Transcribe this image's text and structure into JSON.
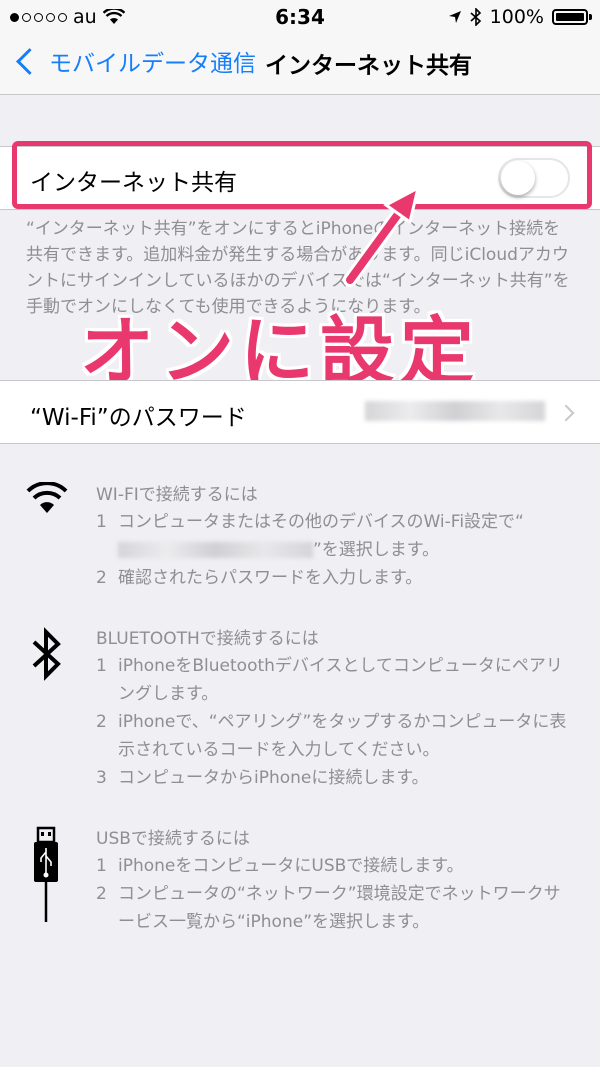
{
  "status_bar": {
    "carrier": "au",
    "time": "6:34",
    "battery": "100%"
  },
  "nav": {
    "back_label": "モバイルデータ通信",
    "title": "インターネット共有"
  },
  "hotspot_toggle": {
    "label": "インターネット共有",
    "enabled": false
  },
  "hotspot_footer": "“インターネット共有”をオンにするとiPhoneのインターネット接続を共有できます。追加料金が発生する場合があります。同じiCloudアカウントにサインインしているほかのデバイスでは“インターネット共有”を手動でオンにしなくても使用できるようになります。",
  "annotation": {
    "callout": "オンに設定",
    "color": "#e8386d"
  },
  "wifi_password": {
    "label": "“Wi-Fi”のパスワード"
  },
  "sections": {
    "wifi": {
      "title": "WI-FIで接続するには",
      "step1_num": "1",
      "step1": "コンピュータまたはその他のデバイスのWi-Fi設定で“",
      "step1_end": "”を選択します。",
      "step2_num": "2",
      "step2": "確認されたらパスワードを入力します。"
    },
    "bluetooth": {
      "title": "BLUETOOTHで接続するには",
      "step1_num": "1",
      "step1": "iPhoneをBluetoothデバイスとしてコンピュータにペアリングします。",
      "step2_num": "2",
      "step2": "iPhoneで、“ペアリング”をタップするかコンピュータに表示されているコードを入力してください。",
      "step3_num": "3",
      "step3": "コンピュータからiPhoneに接続します。"
    },
    "usb": {
      "title": "USBで接続するには",
      "step1_num": "1",
      "step1": "iPhoneをコンピュータにUSBで接続します。",
      "step2_num": "2",
      "step2": "コンピュータの“ネットワーク”環境設定でネットワークサービス一覧から“iPhone”を選択します。"
    }
  },
  "colors": {
    "ios_blue": "#157efb",
    "background": "#efeff4",
    "secondary_text": "#8e8e93"
  },
  "icons": [
    "wifi-icon",
    "bluetooth-icon",
    "usb-icon",
    "back-chevron-icon",
    "location-icon",
    "battery-icon"
  ]
}
